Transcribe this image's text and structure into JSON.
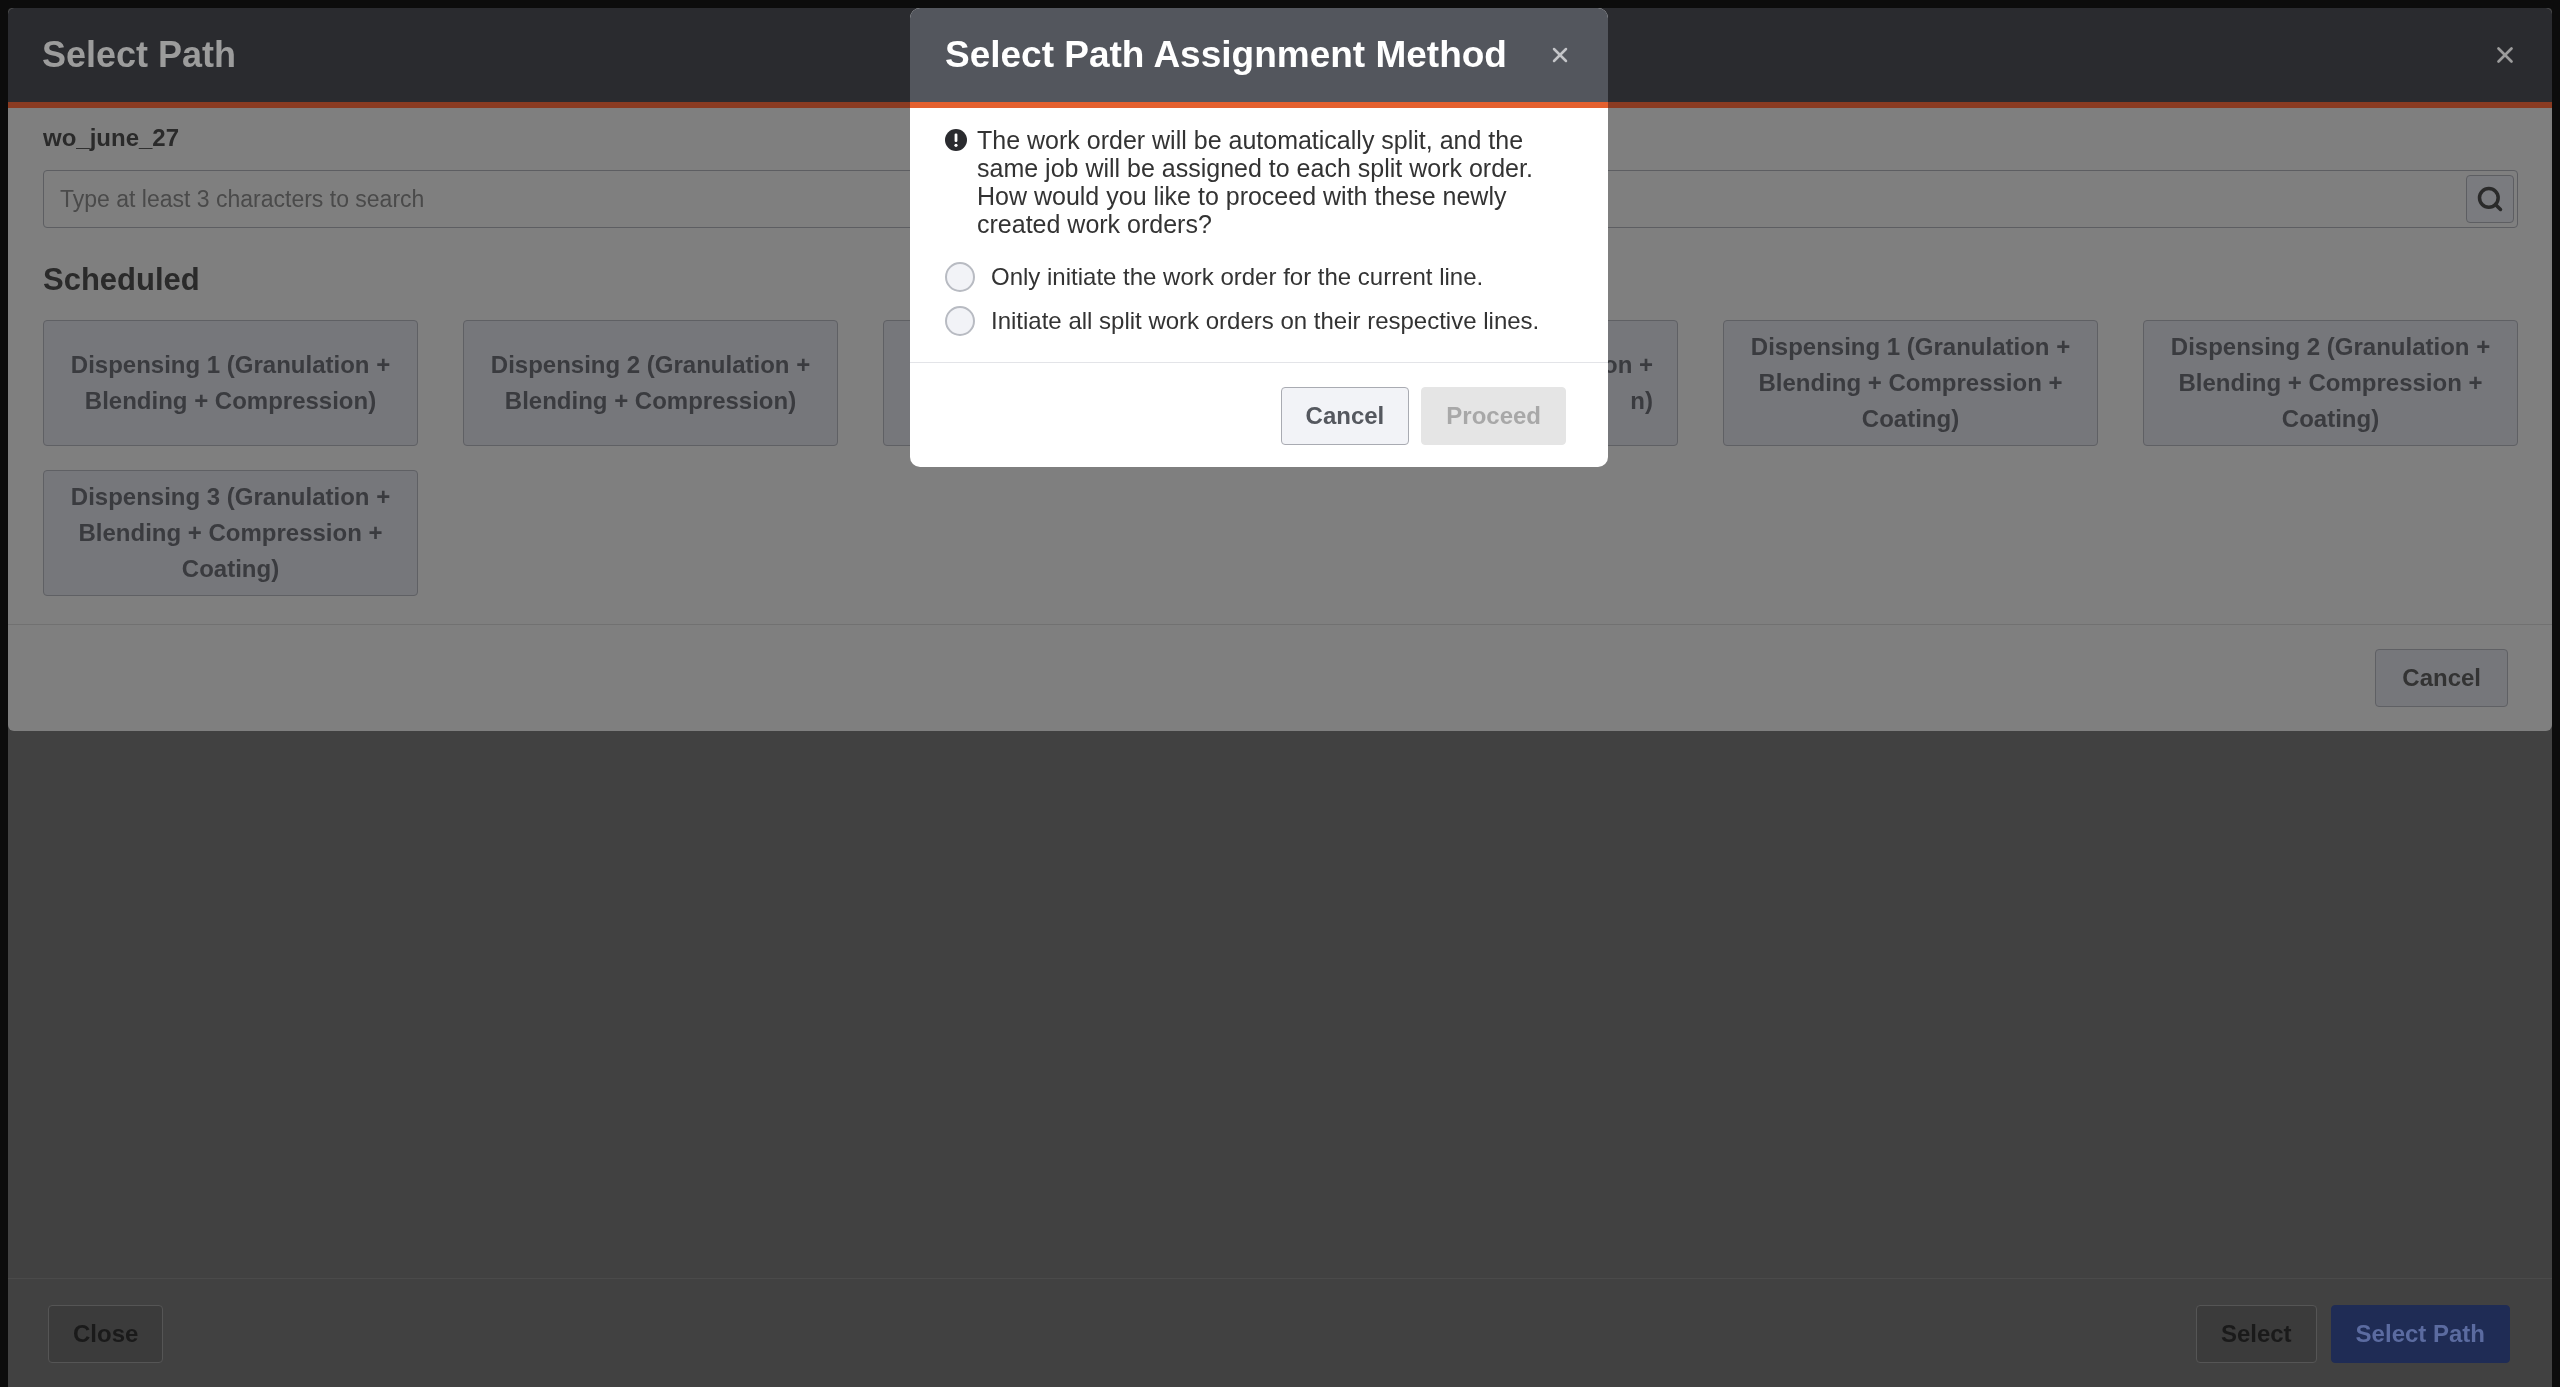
{
  "page_footer": {
    "buttons": [
      {
        "label": "Close",
        "kind": "default"
      },
      {
        "label": "Select",
        "kind": "default"
      },
      {
        "label": "Select Path",
        "kind": "primary"
      }
    ]
  },
  "select_path_dialog": {
    "title": "Select Path",
    "work_order": "wo_june_27",
    "search": {
      "placeholder": "Type at least 3 characters to search"
    },
    "section_title": "Scheduled",
    "cards": [
      {
        "kind": "path",
        "label": "Dispensing 1 (Granulation + Blending + Compression)"
      },
      {
        "kind": "path",
        "label": "Dispensing 2 (Granulation + Blending + Compression)"
      },
      {
        "kind": "hidden"
      },
      {
        "kind": "partial",
        "lines": [
          "on +",
          "n)"
        ]
      },
      {
        "kind": "path",
        "label": "Dispensing 1 (Granulation + Blending + Compression + Coating)"
      },
      {
        "kind": "path",
        "label": "Dispensing 2 (Granulation + Blending + Compression + Coating)"
      },
      {
        "kind": "path",
        "label": "Dispensing 3 (Granulation + Blending + Compression + Coating)"
      }
    ],
    "buttons": [
      "Cancel"
    ]
  },
  "assignment_dialog": {
    "title": "Select Path Assignment Method",
    "message": "The work order will be automatically split, and the same job will be assigned to each split work order. How would you like to proceed with these newly created work orders?",
    "options": [
      {
        "label": "Only initiate the work order for the current line.",
        "selected": false
      },
      {
        "label": "Initiate all split work orders on their respective lines.",
        "selected": false
      }
    ],
    "buttons": [
      {
        "label": "Cancel",
        "disabled": false
      },
      {
        "label": "Proceed",
        "disabled": true
      }
    ]
  }
}
